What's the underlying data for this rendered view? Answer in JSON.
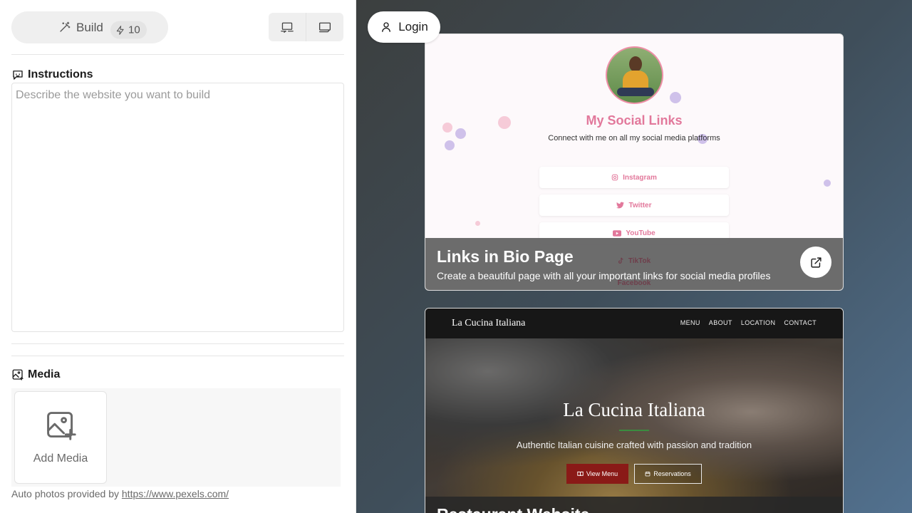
{
  "left": {
    "build_label": "Build",
    "credits": "10",
    "instructions_title": "Instructions",
    "instructions_placeholder": "Describe the website you want to build",
    "instructions_value": "",
    "media_title": "Media",
    "add_media_label": "Add Media",
    "credit_text": "Auto photos provided by ",
    "credit_link": "https://www.pexels.com/"
  },
  "right": {
    "login_label": "Login",
    "templates": [
      {
        "preview": {
          "title": "My Social Links",
          "subtitle": "Connect with me on all my social media platforms",
          "links": [
            "Instagram",
            "Twitter",
            "YouTube",
            "TikTok",
            "Facebook"
          ]
        },
        "title": "Links in Bio Page",
        "description": "Create a beautiful page with all your important links for social media profiles"
      },
      {
        "preview": {
          "brand": "La Cucina Italiana",
          "nav": [
            "MENU",
            "ABOUT",
            "LOCATION",
            "CONTACT"
          ],
          "hero_title": "La Cucina Italiana",
          "hero_subtitle": "Authentic Italian cuisine crafted with passion and tradition",
          "primary_button": "View Menu",
          "secondary_button": "Reservations"
        },
        "title": "Restaurant Website"
      }
    ]
  },
  "colors": {
    "accent_pink": "#e2789b",
    "restaurant_red": "#8a1a17",
    "restaurant_green": "#3a8c3f"
  }
}
